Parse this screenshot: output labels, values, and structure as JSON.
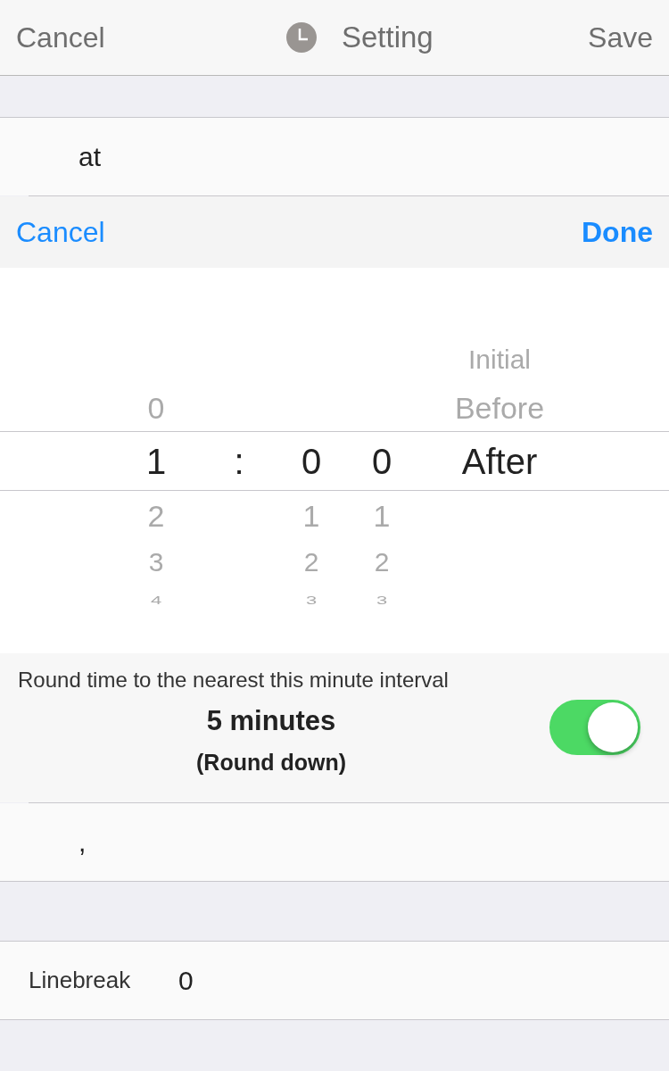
{
  "nav": {
    "cancel": "Cancel",
    "title": "Setting",
    "save": "Save"
  },
  "text_row": {
    "value": "at"
  },
  "toolbar": {
    "cancel": "Cancel",
    "done": "Done"
  },
  "picker": {
    "columns": [
      {
        "kind": "wheel",
        "items": [
          {
            "label": "0",
            "selected": false
          },
          {
            "label": "1",
            "selected": true
          },
          {
            "label": "2",
            "selected": false
          },
          {
            "label": "3",
            "selected": false
          },
          {
            "label": "4",
            "selected": false
          }
        ]
      },
      {
        "kind": "separator",
        "label": ":"
      },
      {
        "kind": "wheel",
        "items": [
          {
            "label": "0",
            "selected": true
          },
          {
            "label": "1",
            "selected": false
          },
          {
            "label": "2",
            "selected": false
          },
          {
            "label": "3",
            "selected": false
          }
        ]
      },
      {
        "kind": "wheel",
        "items": [
          {
            "label": "0",
            "selected": true
          },
          {
            "label": "1",
            "selected": false
          },
          {
            "label": "2",
            "selected": false
          },
          {
            "label": "3",
            "selected": false
          }
        ]
      },
      {
        "kind": "wheel",
        "items": [
          {
            "label": "Initial",
            "selected": false
          },
          {
            "label": "Before",
            "selected": false
          },
          {
            "label": "After",
            "selected": true
          }
        ]
      }
    ]
  },
  "rounding": {
    "label": "Round time to the nearest this minute interval",
    "interval": "5 minutes",
    "mode": "(Round down)",
    "on": true
  },
  "separator_row": {
    "value": ","
  },
  "linebreak": {
    "label": "Linebreak",
    "value": "0"
  }
}
